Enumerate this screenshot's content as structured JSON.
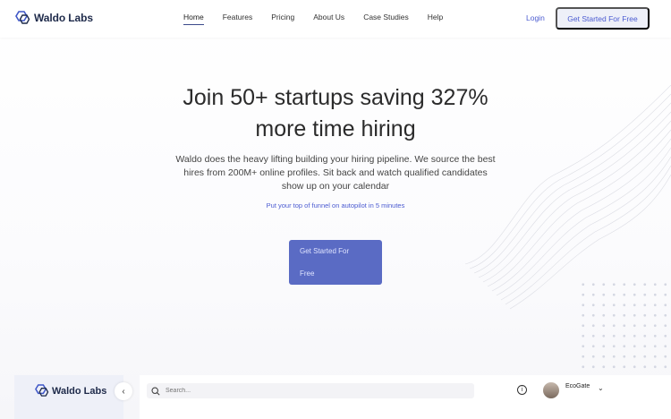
{
  "brand": {
    "name": "Waldo Labs"
  },
  "nav": {
    "links": [
      "Home",
      "Features",
      "Pricing",
      "About Us",
      "Case Studies",
      "Help"
    ],
    "active": "Home",
    "login": "Login",
    "cta": "Get Started For Free"
  },
  "hero": {
    "headline_line1": "Join 50+ startups saving 327%",
    "headline_line2": "more time hiring",
    "subheading": "Waldo does the heavy lifting building your hiring pipeline. We source the best hires from 200M+ online profiles. Sit back and watch qualified candidates show up on your calendar",
    "tagline": "Put your top of funnel on autopilot in 5 minutes",
    "cta_line1": "Get Started For",
    "cta_line2": "Free"
  },
  "preview": {
    "brand": "Waldo Labs",
    "collapse_icon": "chevron-left-icon",
    "search_placeholder": "Search...",
    "info_icon": "info-icon",
    "company": "EcoGate",
    "dropdown_icon": "chevron-down-icon"
  },
  "colors": {
    "accent": "#4b5bd1",
    "button": "#5a6bc4",
    "brand_dark": "#1e2a4a"
  }
}
